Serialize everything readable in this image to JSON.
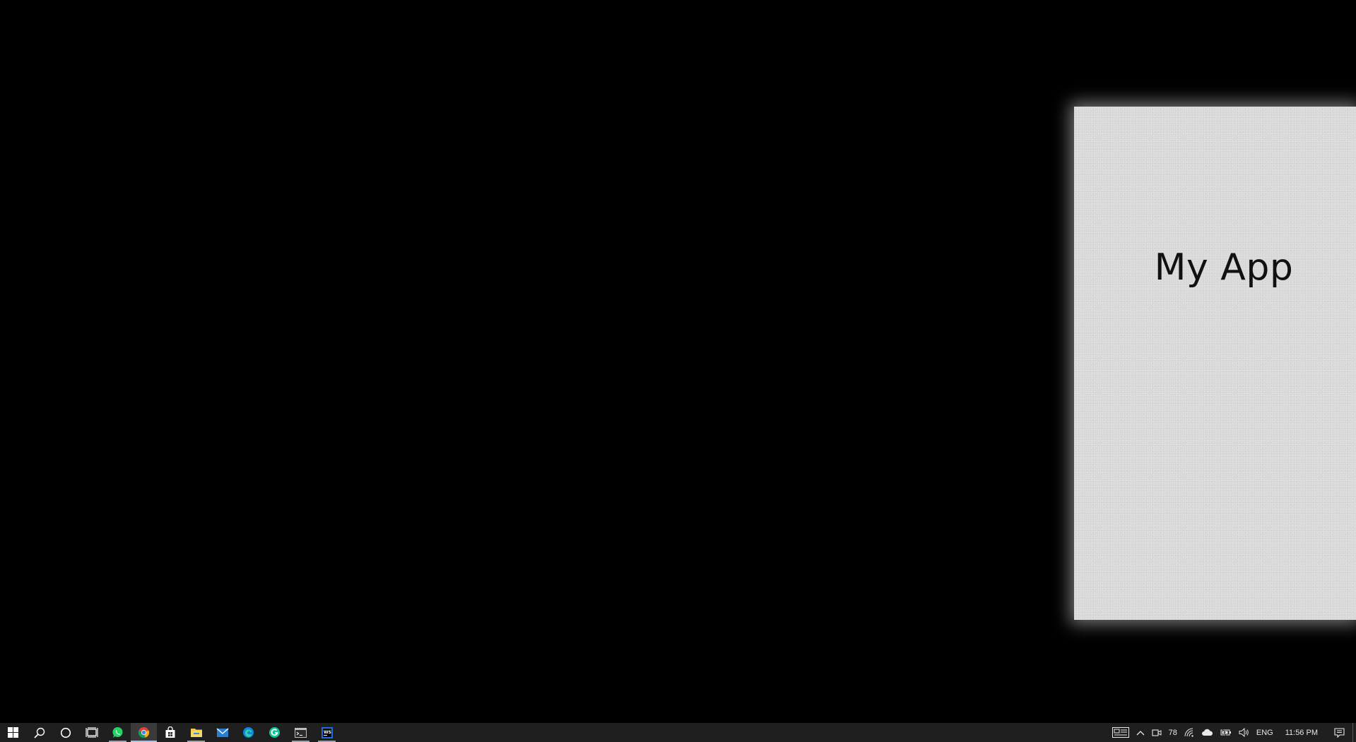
{
  "app": {
    "title": "My App"
  },
  "taskbar": {
    "pinned": [
      {
        "name": "start-button",
        "icon": "windows-logo-icon"
      },
      {
        "name": "search-button",
        "icon": "search-icon"
      },
      {
        "name": "cortana-button",
        "icon": "cortana-circle-icon"
      },
      {
        "name": "task-view-button",
        "icon": "task-view-icon"
      },
      {
        "name": "whatsapp-button",
        "icon": "whatsapp-icon"
      },
      {
        "name": "chrome-button",
        "icon": "chrome-icon"
      },
      {
        "name": "store-button",
        "icon": "store-bag-icon"
      },
      {
        "name": "file-explorer-button",
        "icon": "folder-icon"
      },
      {
        "name": "mail-button",
        "icon": "mail-icon"
      },
      {
        "name": "edge-button",
        "icon": "edge-icon"
      },
      {
        "name": "grammarly-button",
        "icon": "grammarly-icon"
      },
      {
        "name": "terminal-button",
        "icon": "terminal-icon"
      },
      {
        "name": "webstorm-button",
        "icon": "webstorm-icon"
      }
    ]
  },
  "tray": {
    "temperature": "78",
    "language": "ENG",
    "time": "11:56 PM"
  },
  "colors": {
    "taskbar_bg": "#1f1f1f",
    "window_bg": "#d9d9d9",
    "desktop_bg": "#000000",
    "whatsapp": "#25d366",
    "chrome_red": "#db4437",
    "chrome_yellow": "#f4b400",
    "chrome_green": "#0f9d58",
    "chrome_blue": "#4285f4",
    "folder": "#f3c94c",
    "mail": "#2a7fd4",
    "edge": "#0c8adf",
    "grammarly": "#15c39a",
    "webstorm": "#1a6fd8"
  }
}
